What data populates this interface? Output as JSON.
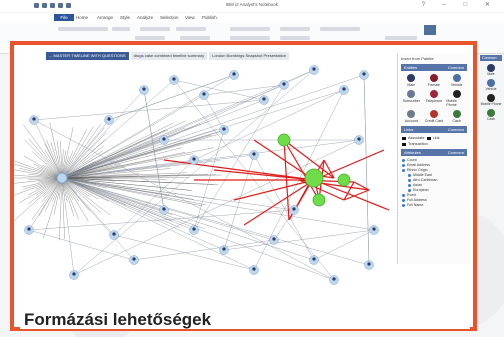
{
  "window": {
    "title": "IBM i2 Analyst's Notebook"
  },
  "menu_tabs": [
    "File",
    "Home",
    "Arrange",
    "Style",
    "Analyze",
    "Selection",
    "View",
    "Publish"
  ],
  "ribbon_groups": [
    "Font",
    "Entity Style",
    "Line Style",
    "Interaction",
    "Formatting"
  ],
  "doc_tabs": [
    "... MASTER TIMELINE WITH QUESTIONS",
    "drugs cake combined timeline summary",
    "London Bombings Snapshot Presentation"
  ],
  "palette": {
    "title": "Insert from Palette",
    "entities_header": "Entities",
    "tab_common": "Common",
    "entities": [
      {
        "label": "Male",
        "color": "#2b3a66"
      },
      {
        "label": "Female",
        "color": "#8a1d2a"
      },
      {
        "label": "Vehicle",
        "color": "#4c6fa5"
      },
      {
        "label": "Subscriber",
        "color": "#6b7894"
      },
      {
        "label": "Telephone",
        "color": "#a1263b"
      },
      {
        "label": "Mobile Phone",
        "color": "#222222"
      },
      {
        "label": "Account",
        "color": "#6c7b8c"
      },
      {
        "label": "Credit Card",
        "color": "#b5342e"
      },
      {
        "label": "Cash",
        "color": "#3c7a3c"
      }
    ],
    "links_header": "Links",
    "links": [
      "Associate",
      "Link",
      "Transaction"
    ],
    "attributes_header": "Attributes",
    "attributes": [
      "Count",
      "Email Address",
      "Ethnic Origin",
      "Middle East",
      "Afro-Caribbean",
      "Asian",
      "European",
      "Event",
      "Full Address",
      "Full Name"
    ]
  },
  "right_panel": {
    "header": "Common",
    "items": [
      {
        "label": "Male",
        "color": "#2b3a66"
      },
      {
        "label": "Vehicle",
        "color": "#4c6fa5"
      },
      {
        "label": "Mobile Phone",
        "color": "#222222"
      },
      {
        "label": "Cash",
        "color": "#3c7a3c"
      }
    ]
  },
  "caption": "Formázási lehetőségek",
  "colors": {
    "accent_frame": "#e8542c",
    "file_tab": "#2b579a",
    "link_red": "#e01b1b",
    "node_green": "#6fdc4a",
    "node_blue": "#bcd6ee"
  }
}
